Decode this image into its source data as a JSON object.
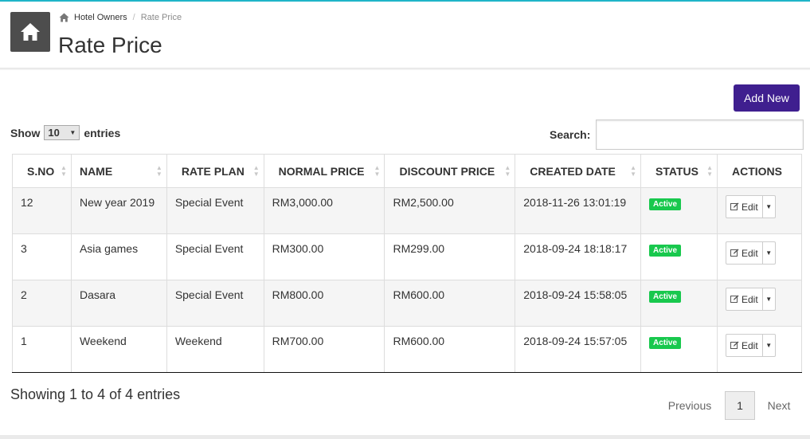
{
  "breadcrumb": {
    "root": "Hotel Owners",
    "current": "Rate Price"
  },
  "page": {
    "title": "Rate Price"
  },
  "toolbar": {
    "add_label": "Add New"
  },
  "length": {
    "prefix": "Show",
    "value": "10",
    "suffix": "entries"
  },
  "search": {
    "label": "Search:",
    "value": ""
  },
  "table": {
    "headers": [
      "S.NO",
      "NAME",
      "RATE PLAN",
      "NORMAL PRICE",
      "DISCOUNT PRICE",
      "CREATED DATE",
      "STATUS",
      "ACTIONS"
    ],
    "rows": [
      {
        "sno": "12",
        "name": "New year 2019",
        "plan": "Special Event",
        "normal": "RM3,000.00",
        "discount": "RM2,500.00",
        "created": "2018-11-26 13:01:19",
        "status": "Active",
        "action": "Edit"
      },
      {
        "sno": "3",
        "name": "Asia games",
        "plan": "Special Event",
        "normal": "RM300.00",
        "discount": "RM299.00",
        "created": "2018-09-24 18:18:17",
        "status": "Active",
        "action": "Edit"
      },
      {
        "sno": "2",
        "name": "Dasara",
        "plan": "Special Event",
        "normal": "RM800.00",
        "discount": "RM600.00",
        "created": "2018-09-24 15:58:05",
        "status": "Active",
        "action": "Edit"
      },
      {
        "sno": "1",
        "name": "Weekend",
        "plan": "Weekend",
        "normal": "RM700.00",
        "discount": "RM600.00",
        "created": "2018-09-24 15:57:05",
        "status": "Active",
        "action": "Edit"
      }
    ]
  },
  "info": "Showing 1 to 4 of 4 entries",
  "pagination": {
    "prev": "Previous",
    "current": "1",
    "next": "Next"
  },
  "colors": {
    "accent": "#3f1f8f",
    "status_active": "#18c84d",
    "top_line": "#1fb5c8"
  },
  "icons": {
    "home": "home-icon",
    "edit": "edit-icon",
    "caret": "caret-down-icon",
    "sort": "sort-icon"
  }
}
